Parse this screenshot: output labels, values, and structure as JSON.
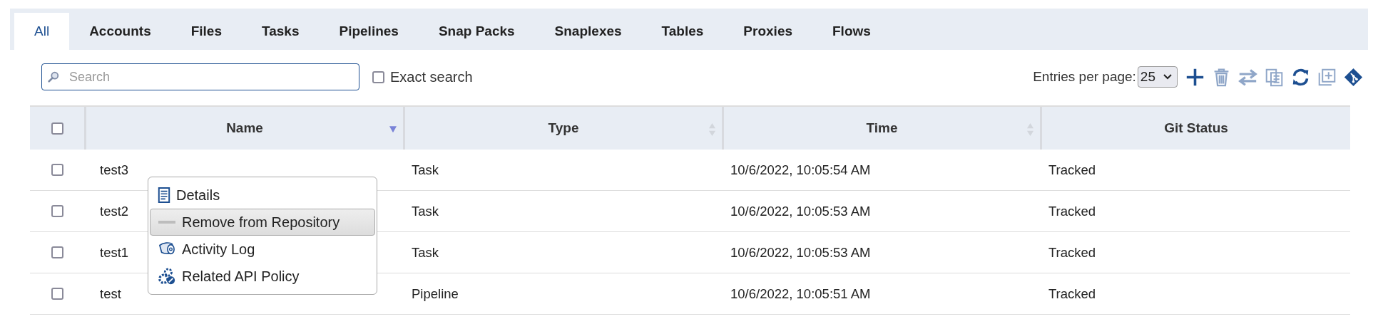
{
  "tabs": [
    {
      "label": "All",
      "selected": true
    },
    {
      "label": "Accounts",
      "selected": false
    },
    {
      "label": "Files",
      "selected": false
    },
    {
      "label": "Tasks",
      "selected": false
    },
    {
      "label": "Pipelines",
      "selected": false
    },
    {
      "label": "Snap Packs",
      "selected": false
    },
    {
      "label": "Snaplexes",
      "selected": false
    },
    {
      "label": "Tables",
      "selected": false
    },
    {
      "label": "Proxies",
      "selected": false
    },
    {
      "label": "Flows",
      "selected": false
    }
  ],
  "search": {
    "placeholder": "Search"
  },
  "exact_search": {
    "label": "Exact search",
    "checked": false
  },
  "entries_per_page": {
    "label": "Entries per page:",
    "value": "25"
  },
  "table": {
    "select_all_checked": false,
    "columns": [
      {
        "label": "Name",
        "sortable": true,
        "sorted": true
      },
      {
        "label": "Type",
        "sortable": true,
        "sorted": false
      },
      {
        "label": "Time",
        "sortable": true,
        "sorted": false
      },
      {
        "label": "Git Status",
        "sortable": false
      }
    ],
    "rows": [
      {
        "checked": false,
        "cells": [
          "test3",
          "Task",
          "10/6/2022, 10:05:54 AM",
          "Tracked"
        ]
      },
      {
        "checked": false,
        "cells": [
          "test2",
          "Task",
          "10/6/2022, 10:05:53 AM",
          "Tracked"
        ]
      },
      {
        "checked": false,
        "cells": [
          "test1",
          "Task",
          "10/6/2022, 10:05:53 AM",
          "Tracked"
        ]
      },
      {
        "checked": false,
        "cells": [
          "test",
          "Pipeline",
          "10/6/2022, 10:05:51 AM",
          "Tracked"
        ]
      }
    ]
  },
  "context_menu": [
    {
      "label": "Details",
      "selected": false
    },
    {
      "label": "Remove from Repository",
      "selected": true
    },
    {
      "label": "Activity Log",
      "selected": false
    },
    {
      "label": "Related API Policy",
      "selected": false
    }
  ]
}
